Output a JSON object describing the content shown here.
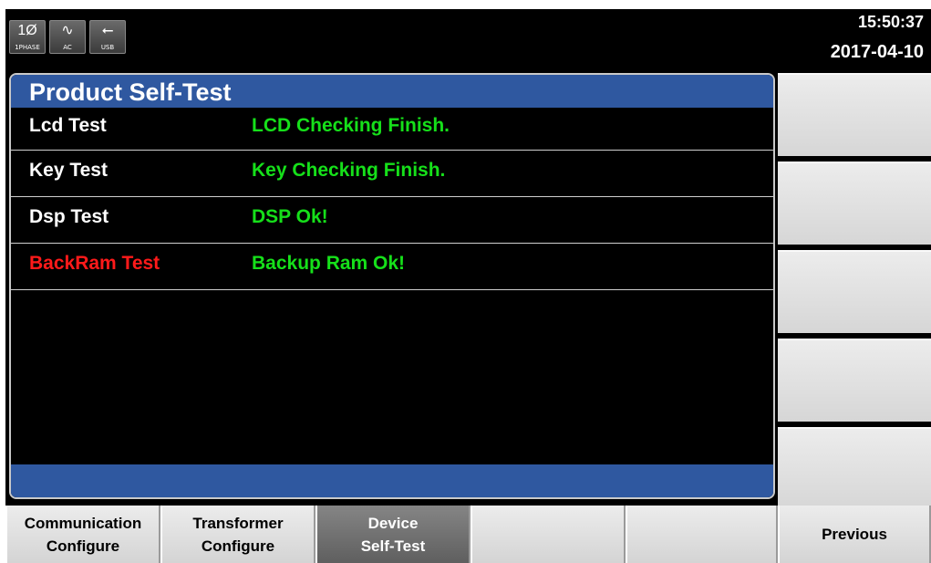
{
  "status": {
    "icons": [
      {
        "name": "phase-icon",
        "glyph": "1Ø",
        "caption": "1PHASE"
      },
      {
        "name": "ac-wave-icon",
        "glyph": "∿",
        "caption": "AC"
      },
      {
        "name": "usb-icon",
        "glyph": "⭠",
        "caption": "USB"
      }
    ],
    "time": "15:50:37",
    "date": "2017-04-10"
  },
  "panel": {
    "title": "Product Self-Test",
    "rows": [
      {
        "name": "Lcd Test",
        "result": "LCD Checking Finish.",
        "name_color": "#ffffff"
      },
      {
        "name": "Key Test",
        "result": "Key Checking Finish.",
        "name_color": "#ffffff"
      },
      {
        "name": "Dsp Test",
        "result": "DSP Ok!",
        "name_color": "#ffffff"
      },
      {
        "name": "BackRam Test",
        "result": "Backup Ram Ok!",
        "name_color": "#ff1a1a"
      }
    ]
  },
  "softkeys": [
    "",
    "",
    "",
    "",
    ""
  ],
  "fkeys": [
    {
      "line1": "Communication",
      "line2": "Configure",
      "active": false
    },
    {
      "line1": "Transformer",
      "line2": "Configure",
      "active": false
    },
    {
      "line1": "Device",
      "line2": "Self-Test",
      "active": true
    },
    {
      "line1": "",
      "line2": "",
      "active": false
    },
    {
      "line1": "",
      "line2": "",
      "active": false
    },
    {
      "line1": "Previous",
      "line2": "",
      "active": false
    }
  ],
  "colors": {
    "accent": "#2f58a0",
    "ok": "#16e01a",
    "alert": "#ff1a1a",
    "active_key": "#6e6e6e"
  }
}
